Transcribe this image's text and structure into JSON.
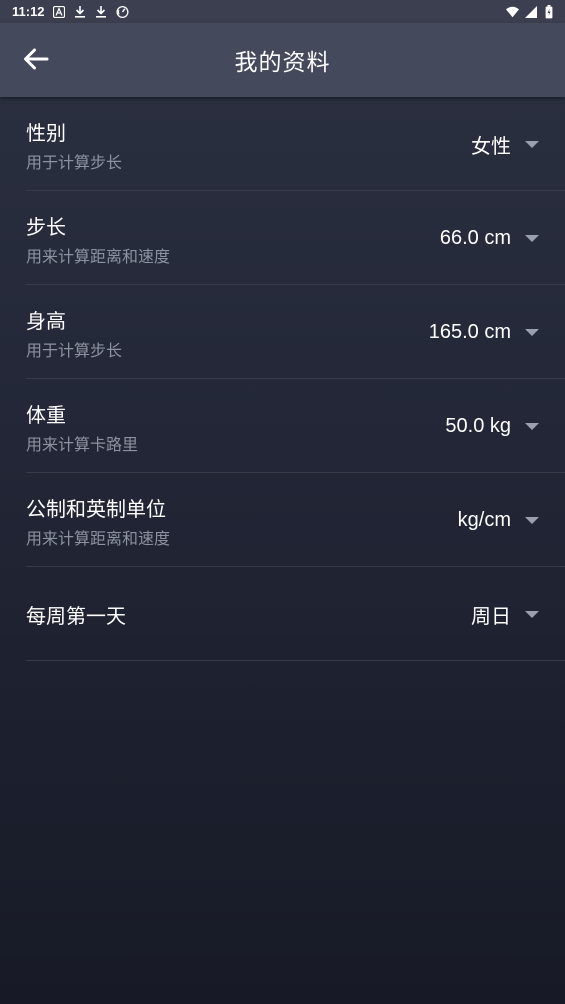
{
  "status_bar": {
    "time": "11:12",
    "icons": [
      "a-text-icon",
      "download-icon",
      "download-icon",
      "speed-icon"
    ],
    "right_icons": [
      "wifi-icon",
      "signal-icon",
      "battery-icon"
    ]
  },
  "header": {
    "title": "我的资料",
    "back_icon": "arrow-left-icon"
  },
  "settings": {
    "items": [
      {
        "title": "性别",
        "subtitle": "用于计算步长",
        "value": "女性"
      },
      {
        "title": "步长",
        "subtitle": "用来计算距离和速度",
        "value": "66.0 cm"
      },
      {
        "title": "身高",
        "subtitle": "用于计算步长",
        "value": "165.0 cm"
      },
      {
        "title": "体重",
        "subtitle": "用来计算卡路里",
        "value": "50.0 kg"
      },
      {
        "title": "公制和英制单位",
        "subtitle": "用来计算距离和速度",
        "value": "kg/cm"
      },
      {
        "title": "每周第一天",
        "value": "周日"
      }
    ]
  },
  "colors": {
    "app_bar": "#444a5c",
    "status_bar": "#3b3f50",
    "background_top": "#2c3142",
    "background_bottom": "#171a26",
    "subtitle_text": "#8d92a0",
    "divider": "#363b4b"
  }
}
